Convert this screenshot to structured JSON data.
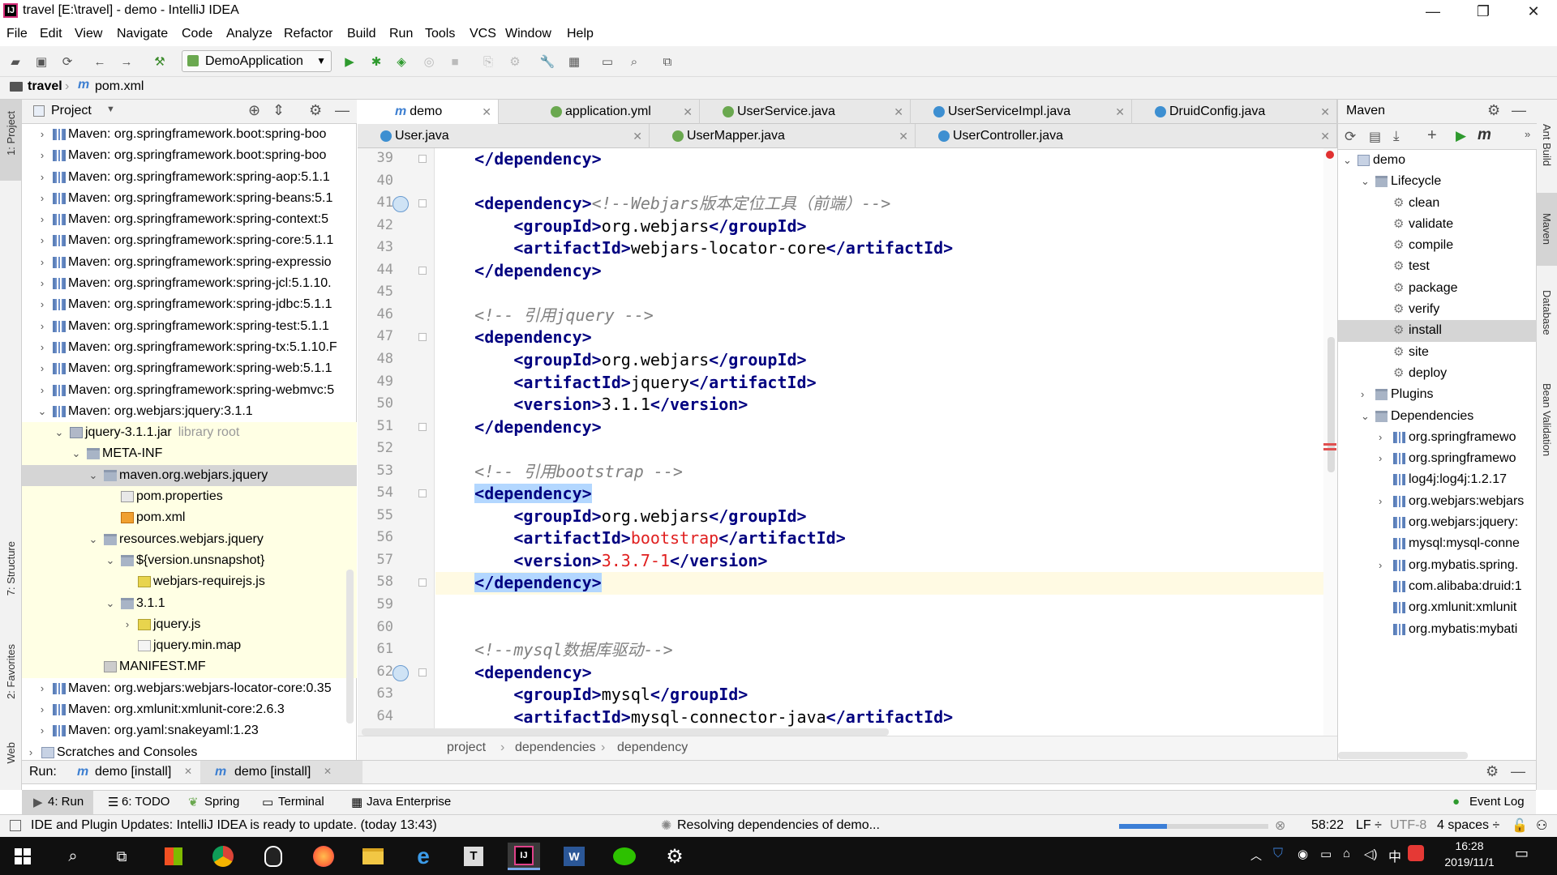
{
  "window": {
    "title": "travel [E:\\travel] - demo - IntelliJ IDEA",
    "minimize": "—",
    "maximize": "❐",
    "close": "✕"
  },
  "menu": [
    "File",
    "Edit",
    "View",
    "Navigate",
    "Code",
    "Analyze",
    "Refactor",
    "Build",
    "Run",
    "Tools",
    "VCS",
    "Window",
    "Help"
  ],
  "toolbar": {
    "run_config": "DemoApplication"
  },
  "breadcrumb": {
    "project": "travel",
    "file": "pom.xml"
  },
  "left_strip": {
    "project": "1: Project",
    "structure": "7: Structure",
    "favorites": "2: Favorites",
    "web": "Web"
  },
  "right_strip": {
    "ant": "Ant Build",
    "maven": "Maven",
    "database": "Database",
    "bean": "Bean Validation"
  },
  "project_panel": {
    "title": "Project",
    "rows": [
      {
        "text": "Maven: org.springframework.boot:spring-boo",
        "indent": 0,
        "arrow": "›",
        "icon": "lib"
      },
      {
        "text": "Maven: org.springframework.boot:spring-boo",
        "indent": 0,
        "arrow": "›",
        "icon": "lib"
      },
      {
        "text": "Maven: org.springframework:spring-aop:5.1.1",
        "indent": 0,
        "arrow": "›",
        "icon": "lib"
      },
      {
        "text": "Maven: org.springframework:spring-beans:5.1",
        "indent": 0,
        "arrow": "›",
        "icon": "lib"
      },
      {
        "text": "Maven: org.springframework:spring-context:5",
        "indent": 0,
        "arrow": "›",
        "icon": "lib"
      },
      {
        "text": "Maven: org.springframework:spring-core:5.1.1",
        "indent": 0,
        "arrow": "›",
        "icon": "lib"
      },
      {
        "text": "Maven: org.springframework:spring-expressio",
        "indent": 0,
        "arrow": "›",
        "icon": "lib"
      },
      {
        "text": "Maven: org.springframework:spring-jcl:5.1.10.",
        "indent": 0,
        "arrow": "›",
        "icon": "lib"
      },
      {
        "text": "Maven: org.springframework:spring-jdbc:5.1.1",
        "indent": 0,
        "arrow": "›",
        "icon": "lib"
      },
      {
        "text": "Maven: org.springframework:spring-test:5.1.1",
        "indent": 0,
        "arrow": "›",
        "icon": "lib"
      },
      {
        "text": "Maven: org.springframework:spring-tx:5.1.10.F",
        "indent": 0,
        "arrow": "›",
        "icon": "lib"
      },
      {
        "text": "Maven: org.springframework:spring-web:5.1.1",
        "indent": 0,
        "arrow": "›",
        "icon": "lib"
      },
      {
        "text": "Maven: org.springframework:spring-webmvc:5",
        "indent": 0,
        "arrow": "›",
        "icon": "lib"
      },
      {
        "text": "Maven: org.webjars:jquery:3.1.1",
        "indent": 0,
        "arrow": "⌄",
        "icon": "lib"
      },
      {
        "text": "jquery-3.1.1.jar",
        "suffix": "library root",
        "indent": 1,
        "arrow": "⌄",
        "icon": "jar",
        "hl": true
      },
      {
        "text": "META-INF",
        "indent": 2,
        "arrow": "⌄",
        "icon": "folder",
        "hl": true
      },
      {
        "text": "maven.org.webjars.jquery",
        "indent": 3,
        "arrow": "⌄",
        "icon": "folder",
        "sel": true
      },
      {
        "text": "pom.properties",
        "indent": 4,
        "arrow": "",
        "icon": "props",
        "hl": true
      },
      {
        "text": "pom.xml",
        "indent": 4,
        "arrow": "",
        "icon": "xml",
        "hl": true
      },
      {
        "text": "resources.webjars.jquery",
        "indent": 3,
        "arrow": "⌄",
        "icon": "folder",
        "hl": true
      },
      {
        "text": "${version.unsnapshot}",
        "indent": 4,
        "arrow": "⌄",
        "icon": "folder",
        "hl": true
      },
      {
        "text": "webjars-requirejs.js",
        "indent": 5,
        "arrow": "",
        "icon": "js",
        "hl": true
      },
      {
        "text": "3.1.1",
        "indent": 4,
        "arrow": "⌄",
        "icon": "folder",
        "hl": true
      },
      {
        "text": "jquery.js",
        "indent": 5,
        "arrow": "›",
        "icon": "js",
        "hl": true
      },
      {
        "text": "jquery.min.map",
        "indent": 5,
        "arrow": "",
        "icon": "file",
        "hl": true
      },
      {
        "text": "MANIFEST.MF",
        "indent": 3,
        "arrow": "",
        "icon": "mf",
        "hl": true
      },
      {
        "text": "Maven: org.webjars:webjars-locator-core:0.35",
        "indent": 0,
        "arrow": "›",
        "icon": "lib"
      },
      {
        "text": "Maven: org.xmlunit:xmlunit-core:2.6.3",
        "indent": 0,
        "arrow": "›",
        "icon": "lib"
      },
      {
        "text": "Maven: org.yaml:snakeyaml:1.23",
        "indent": 0,
        "arrow": "›",
        "icon": "lib"
      },
      {
        "text": "Scratches and Consoles",
        "indent": -1,
        "arrow": "›",
        "icon": "scratch"
      }
    ]
  },
  "editor": {
    "tabs_row1": [
      {
        "label": "demo",
        "icon": "m",
        "active": true
      },
      {
        "label": "application.yml",
        "icon": "yml"
      },
      {
        "label": "UserService.java",
        "icon": "interface"
      },
      {
        "label": "UserServiceImpl.java",
        "icon": "class"
      },
      {
        "label": "DruidConfig.java",
        "icon": "class"
      }
    ],
    "tabs_row2": [
      {
        "label": "User.java",
        "icon": "class"
      },
      {
        "label": "UserMapper.java",
        "icon": "interface"
      },
      {
        "label": "UserController.java",
        "icon": "class"
      }
    ],
    "lines": [
      {
        "n": "39",
        "html": "    <span class='tg'>&lt;/dependency&gt;</span>"
      },
      {
        "n": "40",
        "html": ""
      },
      {
        "n": "41",
        "html": "    <span class='tg'>&lt;dependency&gt;</span><span class='cm'>&lt;!--Webjars版本定位工具（前端）--&gt;</span>"
      },
      {
        "n": "42",
        "html": "        <span class='tg'>&lt;groupId&gt;</span>org.webjars<span class='tg'>&lt;/groupId&gt;</span>"
      },
      {
        "n": "43",
        "html": "        <span class='tg'>&lt;artifactId&gt;</span>webjars-locator-core<span class='tg'>&lt;/artifactId&gt;</span>"
      },
      {
        "n": "44",
        "html": "    <span class='tg'>&lt;/dependency&gt;</span>"
      },
      {
        "n": "45",
        "html": ""
      },
      {
        "n": "46",
        "html": "    <span class='cm'>&lt;!-- 引用jquery --&gt;</span>"
      },
      {
        "n": "47",
        "html": "    <span class='tg'>&lt;dependency&gt;</span>"
      },
      {
        "n": "48",
        "html": "        <span class='tg'>&lt;groupId&gt;</span>org.webjars<span class='tg'>&lt;/groupId&gt;</span>"
      },
      {
        "n": "49",
        "html": "        <span class='tg'>&lt;artifactId&gt;</span>jquery<span class='tg'>&lt;/artifactId&gt;</span>"
      },
      {
        "n": "50",
        "html": "        <span class='tg'>&lt;version&gt;</span>3.1.1<span class='tg'>&lt;/version&gt;</span>"
      },
      {
        "n": "51",
        "html": "    <span class='tg'>&lt;/dependency&gt;</span>"
      },
      {
        "n": "52",
        "html": ""
      },
      {
        "n": "53",
        "html": "    <span class='cm'>&lt;!-- 引用bootstrap --&gt;</span>"
      },
      {
        "n": "54",
        "html": "    <span class='tg hlb'>&lt;dependency&gt;</span>"
      },
      {
        "n": "55",
        "html": "        <span class='tg'>&lt;groupId&gt;</span>org.webjars<span class='tg'>&lt;/groupId&gt;</span>"
      },
      {
        "n": "56",
        "html": "        <span class='tg'>&lt;artifactId&gt;</span><span class='red'>bootstrap</span><span class='tg'>&lt;/artifactId&gt;</span>"
      },
      {
        "n": "57",
        "html": "        <span class='tg'>&lt;version&gt;</span><span class='red'>3.3.7-1</span><span class='tg'>&lt;/version&gt;</span>"
      },
      {
        "n": "58",
        "html": "    <span class='tg hlb'>&lt;/dependency&gt;</span>",
        "current": true
      },
      {
        "n": "59",
        "html": ""
      },
      {
        "n": "60",
        "html": ""
      },
      {
        "n": "61",
        "html": "    <span class='cm'>&lt;!--mysql数据库驱动--&gt;</span>"
      },
      {
        "n": "62",
        "html": "    <span class='tg'>&lt;dependency&gt;</span>"
      },
      {
        "n": "63",
        "html": "        <span class='tg'>&lt;groupId&gt;</span>mysql<span class='tg'>&lt;/groupId&gt;</span>"
      },
      {
        "n": "64",
        "html": "        <span class='tg'>&lt;artifactId&gt;</span>mysql-connector-java<span class='tg'>&lt;/artifactId&gt;</span>"
      }
    ],
    "crumbs": [
      "project",
      "dependencies",
      "dependency"
    ]
  },
  "maven": {
    "title": "Maven",
    "tree": [
      {
        "text": "demo",
        "indent": 0,
        "arrow": "⌄",
        "icon": "m"
      },
      {
        "text": "Lifecycle",
        "indent": 1,
        "arrow": "⌄",
        "icon": "folder"
      },
      {
        "text": "clean",
        "indent": 2,
        "arrow": "",
        "icon": "gear"
      },
      {
        "text": "validate",
        "indent": 2,
        "arrow": "",
        "icon": "gear"
      },
      {
        "text": "compile",
        "indent": 2,
        "arrow": "",
        "icon": "gear"
      },
      {
        "text": "test",
        "indent": 2,
        "arrow": "",
        "icon": "gear"
      },
      {
        "text": "package",
        "indent": 2,
        "arrow": "",
        "icon": "gear"
      },
      {
        "text": "verify",
        "indent": 2,
        "arrow": "",
        "icon": "gear"
      },
      {
        "text": "install",
        "indent": 2,
        "arrow": "",
        "icon": "gear",
        "sel": true
      },
      {
        "text": "site",
        "indent": 2,
        "arrow": "",
        "icon": "gear"
      },
      {
        "text": "deploy",
        "indent": 2,
        "arrow": "",
        "icon": "gear"
      },
      {
        "text": "Plugins",
        "indent": 1,
        "arrow": "›",
        "icon": "folder"
      },
      {
        "text": "Dependencies",
        "indent": 1,
        "arrow": "⌄",
        "icon": "folder"
      },
      {
        "text": "org.springframewo",
        "indent": 2,
        "arrow": "›",
        "icon": "lib"
      },
      {
        "text": "org.springframewo",
        "indent": 2,
        "arrow": "›",
        "icon": "lib"
      },
      {
        "text": "log4j:log4j:1.2.17",
        "indent": 2,
        "arrow": "",
        "icon": "lib"
      },
      {
        "text": "org.webjars:webjars",
        "indent": 2,
        "arrow": "›",
        "icon": "lib"
      },
      {
        "text": "org.webjars:jquery:",
        "indent": 2,
        "arrow": "",
        "icon": "lib"
      },
      {
        "text": "mysql:mysql-conne",
        "indent": 2,
        "arrow": "",
        "icon": "lib"
      },
      {
        "text": "org.mybatis.spring.",
        "indent": 2,
        "arrow": "›",
        "icon": "lib"
      },
      {
        "text": "com.alibaba:druid:1",
        "indent": 2,
        "arrow": "",
        "icon": "lib"
      },
      {
        "text": "org.xmlunit:xmlunit",
        "indent": 2,
        "arrow": "",
        "icon": "lib"
      },
      {
        "text": "org.mybatis:mybati",
        "indent": 2,
        "arrow": "",
        "icon": "lib"
      }
    ]
  },
  "run_bar": {
    "label": "Run:",
    "tabs": [
      "demo [install]",
      "demo [install]"
    ]
  },
  "bottom_tabs": {
    "run": "4: Run",
    "todo": "6: TODO",
    "spring": "Spring",
    "terminal": "Terminal",
    "java_ee": "Java Enterprise",
    "event_log": "Event Log"
  },
  "status": {
    "message": "IDE and Plugin Updates: IntelliJ IDEA is ready to update. (today 13:43)",
    "progress_text": "Resolving dependencies of demo...",
    "progress_fraction": 0.32,
    "position": "58:22",
    "line_sep": "LF ÷",
    "encoding": "UTF-8",
    "indent": "4 spaces ÷"
  },
  "taskbar": {
    "time": "16:28",
    "date": "2019/11/1",
    "ime": "中"
  }
}
